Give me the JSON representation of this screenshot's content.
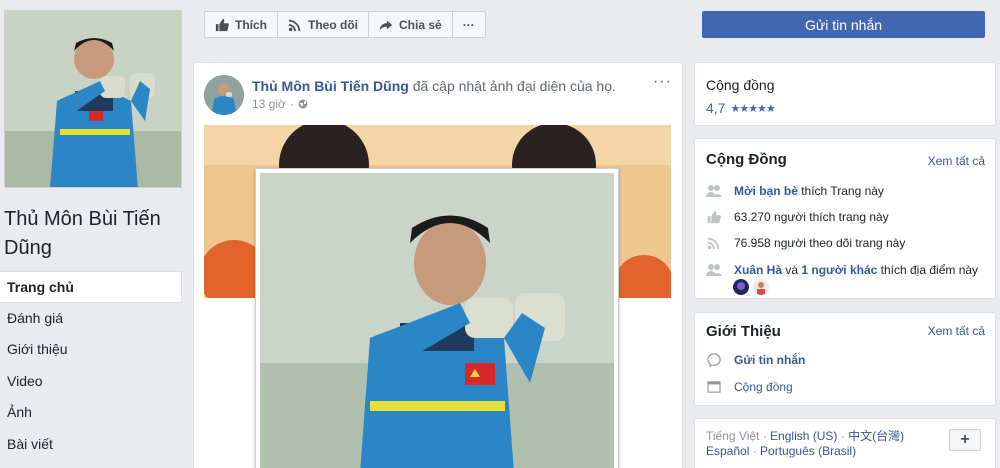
{
  "page": {
    "name": "Thủ Môn Bùi Tiến Dũng"
  },
  "nav": {
    "items": [
      "Trang chủ",
      "Đánh giá",
      "Giới thiệu",
      "Video",
      "Ảnh",
      "Bài viết"
    ]
  },
  "actions": {
    "like": "Thích",
    "follow": "Theo dõi",
    "share": "Chia sẻ",
    "more": "···",
    "send_message": "Gửi tin nhắn"
  },
  "post": {
    "author": "Thủ Môn Bùi Tiến Dũng",
    "action_text": "đã cập nhật ảnh đại diện của họ.",
    "time": "13 giờ",
    "more": "···"
  },
  "community_rating": {
    "title": "Cộng đồng",
    "score": "4,7",
    "stars": "★★★★★"
  },
  "community": {
    "title": "Cộng Đồng",
    "see_all": "Xem tất cả",
    "invite_link": "Mời bạn bè",
    "invite_text": "thích Trang này",
    "likes": "63.270 người thích trang này",
    "follows": "76.958 người theo dõi trang này",
    "checkin_name": "Xuân Hà",
    "checkin_and": "và",
    "checkin_others": "1 người khác",
    "checkin_text": "thích địa điểm này"
  },
  "about": {
    "title": "Giới Thiệu",
    "see_all": "Xem tất cả",
    "send_message": "Gửi tin nhắn",
    "community": "Cộng đồng"
  },
  "languages": {
    "current": "Tiếng Việt",
    "sep": " · ",
    "english": "English (US)",
    "chinese": "中文(台灣)",
    "spanish": "Español",
    "portuguese": "Português (Brasil)",
    "plus": "+"
  },
  "colors": {
    "brand": "#4267b2",
    "link": "#365899",
    "background": "#e9ebee"
  }
}
